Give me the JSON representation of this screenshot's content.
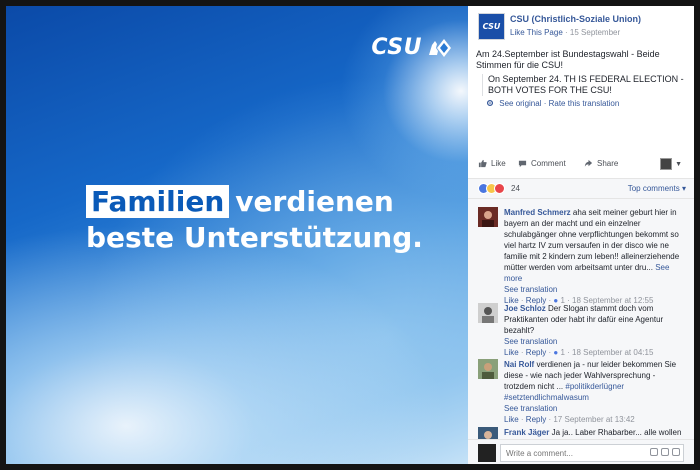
{
  "colors": {
    "photo_blue": "#1668c8",
    "link": "#365899",
    "logo_white": "#ffffff"
  },
  "photo": {
    "logo_text": "CSU",
    "logo_icon": "lion-rhombus-icon",
    "headline_box": "Familien",
    "headline_rest": "verdienen",
    "headline_line2": "beste Unterstützung."
  },
  "post": {
    "avatar_text": "CSU",
    "page_name": "CSU (Christlich-Soziale Union)",
    "like_page": "Like This Page",
    "date": "15 September",
    "text": "Am 24.September ist Bundestagswahl - Beide Stimmen für die CSU!",
    "translation": "On September 24. TH IS FEDERAL ELECTION - BOTH VOTES FOR THE CSU!",
    "see_original": "See original",
    "rate_translation": "Rate this translation"
  },
  "actions": {
    "like": "Like",
    "comment": "Comment",
    "share": "Share"
  },
  "reactions": {
    "count": "24",
    "top_comments": "Top comments"
  },
  "comments": [
    {
      "name": "Manfred Schmerz",
      "text": "aha seit meiner geburt hier in bayern an der macht und ein einzelner schulabgänger ohne verpflichtungen bekommt so viel hartz IV zum versaufen in der disco wie ne familie mit 2 kindern zum leben!! alleinerziehende mütter werden vom arbeitsamt unter dru...",
      "see_more": "See more",
      "see_translation": "See translation",
      "like": "Like",
      "reply": "Reply",
      "likes": "1",
      "time": "18 September at 12:55"
    },
    {
      "name": "Joe Schloz",
      "text": "Der Slogan stammt doch vom Praktikanten oder habt ihr dafür eine Agentur bezahlt?",
      "see_translation": "See translation",
      "like": "Like",
      "reply": "Reply",
      "likes": "1",
      "time": "18 September at 04:15"
    },
    {
      "name": "Nai Rolf",
      "text": "verdienen ja - nur leider bekommen Sie diese - wie nach jeder Wahlversprechung - trotzdem nicht ...",
      "hashtags": "#politikderlügner #setztendlichmalwasum",
      "see_translation": "See translation",
      "like": "Like",
      "reply": "Reply",
      "time": "17 September at 13:42"
    },
    {
      "name": "Frank Jäger",
      "text": "Ja ja.. Laber Rhabarber... alle wollen"
    }
  ],
  "compose": {
    "placeholder": "Write a comment..."
  }
}
